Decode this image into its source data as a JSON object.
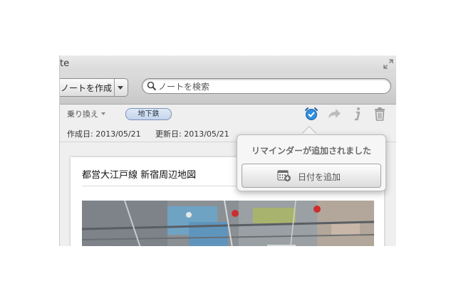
{
  "window": {
    "title_fragment": "te"
  },
  "toolbar": {
    "create_note_label": "ノートを作成",
    "search_placeholder": "ノートを検索"
  },
  "note_toolbar": {
    "notebook_label": "乗り換え",
    "tag_label": "地下鉄"
  },
  "meta": {
    "created": "作成日: 2013/05/21",
    "updated": "更新日: 2013/05/21"
  },
  "note": {
    "title": "都営大江戸線 新宿周辺地図"
  },
  "popover": {
    "message": "リマインダーが追加されました",
    "add_date_label": "日付を追加"
  },
  "icons": {
    "fullscreen": "fullscreen-arrows-icon",
    "search": "search-icon",
    "reminder": "alarm-clock-check-icon",
    "share": "share-arrow-icon",
    "info": "info-icon",
    "trash": "trash-icon",
    "calendar": "calendar-add-icon"
  },
  "colors": {
    "reminder_blue": "#2f8fe0",
    "tag_chip": "#c9daf0"
  }
}
